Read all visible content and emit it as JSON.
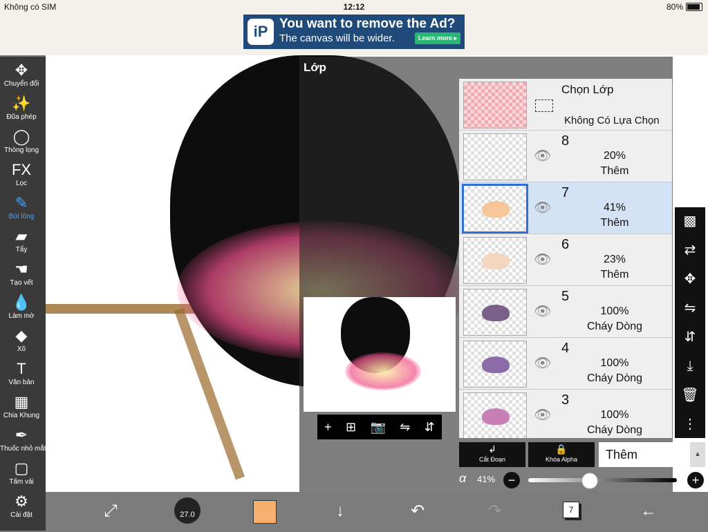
{
  "status_bar": {
    "carrier": "Không có SIM",
    "time": "12:12",
    "battery": "80%"
  },
  "ad": {
    "logo": "iP",
    "headline": "You want to remove the Ad?",
    "subline": "The canvas will be wider.",
    "button": "Learn more ▸"
  },
  "left_tools": [
    {
      "label": "Chuyển đổi",
      "icon": "move-icon",
      "glyph": "✥"
    },
    {
      "label": "Đũa phép",
      "icon": "magic-wand-icon",
      "glyph": "✨"
    },
    {
      "label": "Thòng lọng",
      "icon": "lasso-icon",
      "glyph": "◯"
    },
    {
      "label": "Lọc",
      "icon": "fx-filter-icon",
      "glyph": "FX"
    },
    {
      "label": "Bút lông",
      "icon": "brush-icon",
      "glyph": "✎"
    },
    {
      "label": "Tẩy",
      "icon": "eraser-icon",
      "glyph": "▰"
    },
    {
      "label": "Tạo vết",
      "icon": "smudge-icon",
      "glyph": "☚"
    },
    {
      "label": "Làm mờ",
      "icon": "blur-drop-icon",
      "glyph": "💧"
    },
    {
      "label": "Xô",
      "icon": "bucket-fill-icon",
      "glyph": "◆"
    },
    {
      "label": "Văn bản",
      "icon": "text-icon",
      "glyph": "T"
    },
    {
      "label": "Chia Khung",
      "icon": "frame-divider-icon",
      "glyph": "▦"
    },
    {
      "label": "Thuốc nhỏ mắt",
      "icon": "eyedropper-icon",
      "glyph": "✒"
    },
    {
      "label": "Tấm vải",
      "icon": "canvas-icon",
      "glyph": "▢"
    },
    {
      "label": "Cài đặt",
      "icon": "gear-icon",
      "glyph": "⚙"
    }
  ],
  "active_tool": "Bút lông",
  "layer_panel": {
    "title": "Lớp",
    "selection_layer": {
      "title": "Chọn Lớp",
      "subtitle": "Không Có Lựa Chọn"
    },
    "layers": [
      {
        "number": "8",
        "opacity": "20%",
        "mode": "Thêm",
        "selected": false,
        "color": ""
      },
      {
        "number": "7",
        "opacity": "41%",
        "mode": "Thêm",
        "selected": true,
        "color": "#f6c69a"
      },
      {
        "number": "6",
        "opacity": "23%",
        "mode": "Thêm",
        "selected": false,
        "color": "#f3d6bf"
      },
      {
        "number": "5",
        "opacity": "100%",
        "mode": "Cháy Dòng",
        "selected": false,
        "color": "#7a5f8a"
      },
      {
        "number": "4",
        "opacity": "100%",
        "mode": "Cháy Dòng",
        "selected": false,
        "color": "#8c6aa8"
      },
      {
        "number": "3",
        "opacity": "100%",
        "mode": "Cháy Dòng",
        "selected": false,
        "color": "#c77fb6"
      }
    ],
    "clip_label": "Cắt Đoạn",
    "alpha_lock_label": "Khóa Alpha",
    "blend_mode": "Thêm",
    "alpha_symbol": "α",
    "opacity_text": "41%",
    "opacity_value": 0.41
  },
  "bottom_toolbar": {
    "brush_size": "27.0",
    "color": "#f6b070",
    "layer_count": "7"
  }
}
